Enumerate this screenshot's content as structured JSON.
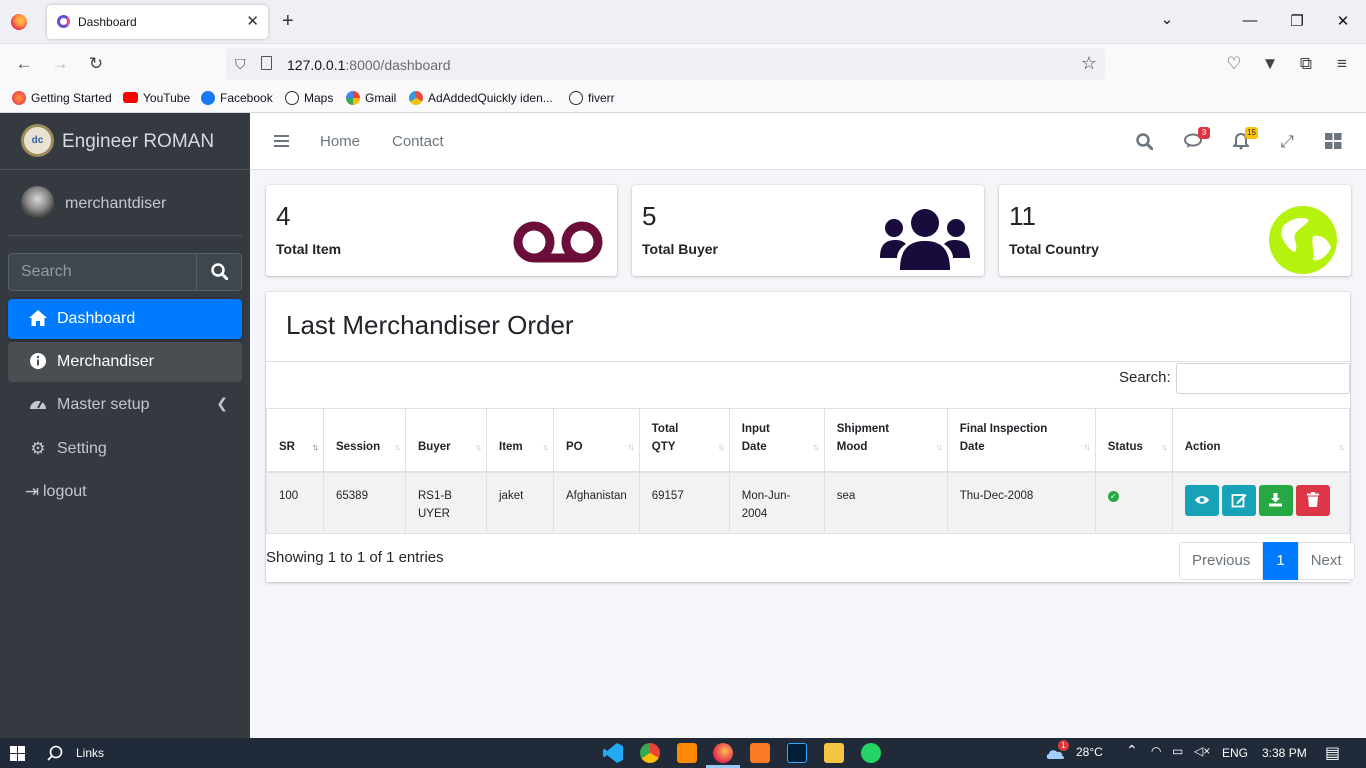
{
  "browser": {
    "tab_title": "Dashboard",
    "url_host": "127.0.0.1",
    "url_rest": ":8000/dashboard",
    "bookmarks": [
      "Getting Started",
      "YouTube",
      "Facebook",
      "Maps",
      "Gmail",
      "AdAddedQuickly iden...",
      "fiverr"
    ]
  },
  "sidebar": {
    "brand": "Engineer ROMAN",
    "logo_text": "dc",
    "user": "merchantdiser",
    "search_placeholder": "Search",
    "menu": [
      {
        "label": "Dashboard",
        "icon": "home-icon"
      },
      {
        "label": "Merchandiser",
        "icon": "info-icon"
      },
      {
        "label": "Master setup",
        "icon": "tachometer-icon"
      },
      {
        "label": "Setting",
        "icon": "gear-icon"
      },
      {
        "label": "logout",
        "icon": "logout-icon"
      }
    ]
  },
  "header": {
    "nav": [
      "Home",
      "Contact"
    ],
    "messages_badge": "3",
    "notifications_badge": "15"
  },
  "stats": [
    {
      "value": "4",
      "label": "Total Item",
      "icon": "voicemail-icon",
      "color": "#6b0f3a"
    },
    {
      "value": "5",
      "label": "Total Buyer",
      "icon": "users-icon",
      "color": "#1a0b3d"
    },
    {
      "value": "11",
      "label": "Total Country",
      "icon": "globe-icon",
      "color": "#b5f20e"
    }
  ],
  "orders": {
    "title": "Last Merchandiser Order",
    "search_label": "Search:",
    "columns": [
      "SR",
      "Session",
      "Buyer",
      "Item",
      "PO",
      "Total QTY",
      "Input Date",
      "Shipment Mood",
      "Final Inspection Date",
      "Status",
      "Action"
    ],
    "rows": [
      {
        "sr": "100",
        "session": "65389",
        "buyer": "RS1-BUYER",
        "item": "jaket",
        "po": "Afghanistan",
        "qty": "69157",
        "input_date": "Mon-Jun-2004",
        "shipment": "sea",
        "final_date": "Thu-Dec-2008"
      }
    ],
    "info": "Showing 1 to 1 of 1 entries",
    "pager": {
      "prev": "Previous",
      "page": "1",
      "next": "Next"
    }
  },
  "taskbar": {
    "search_label": "Links",
    "temperature": "28°C",
    "lang": "ENG",
    "time": "3:38 PM",
    "weather_badge": "1"
  }
}
